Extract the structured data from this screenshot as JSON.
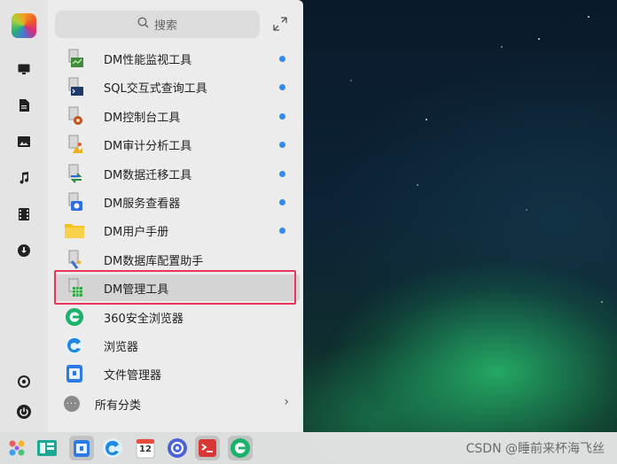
{
  "search": {
    "label": "搜索"
  },
  "apps": [
    {
      "label": "DM性能监视工具",
      "new": true,
      "icon": "dm-monitor-icon"
    },
    {
      "label": "SQL交互式查询工具",
      "new": true,
      "icon": "sql-console-icon"
    },
    {
      "label": "DM控制台工具",
      "new": true,
      "icon": "dm-console-icon"
    },
    {
      "label": "DM审计分析工具",
      "new": true,
      "icon": "dm-audit-icon"
    },
    {
      "label": "DM数据迁移工具",
      "new": true,
      "icon": "dm-migrate-icon"
    },
    {
      "label": "DM服务查看器",
      "new": true,
      "icon": "dm-service-icon"
    },
    {
      "label": "DM用户手册",
      "new": true,
      "icon": "folder-icon"
    },
    {
      "label": "DM数据库配置助手",
      "new": false,
      "icon": "dm-dbca-icon"
    },
    {
      "label": "DM管理工具",
      "new": false,
      "icon": "dm-manager-icon",
      "selected": true
    },
    {
      "label": "360安全浏览器",
      "new": false,
      "icon": "browser-360-icon"
    },
    {
      "label": "浏览器",
      "new": false,
      "icon": "browser-icon"
    },
    {
      "label": "文件管理器",
      "new": false,
      "icon": "file-manager-icon"
    }
  ],
  "all_categories": {
    "label": "所有分类"
  },
  "watermark": "CSDN @睡前来杯海飞丝",
  "calendar_day": "12",
  "colors": {
    "accent_dot": "#2f8bf0",
    "highlight": "#e8365d"
  }
}
